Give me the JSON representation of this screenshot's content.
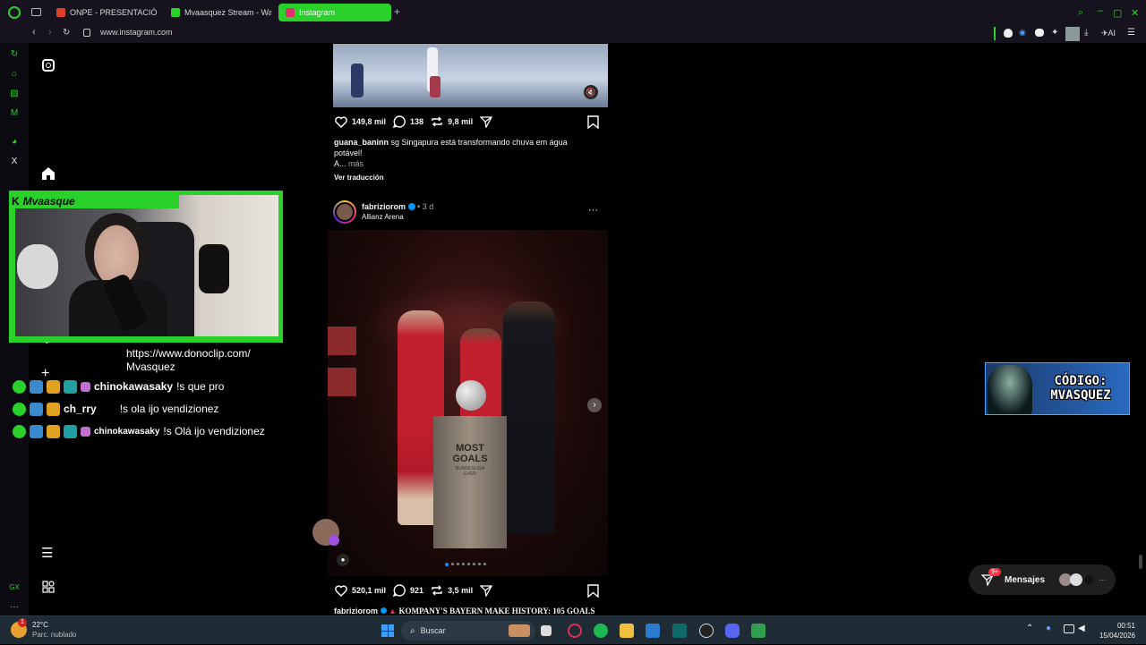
{
  "browser": {
    "tabs": [
      {
        "label": "ONPE - PRESENTACIÓN D",
        "favicon_color": "#e0402b"
      },
      {
        "label": "Mvaasquez Stream - Watc",
        "favicon_color": "#2bd12b"
      },
      {
        "label": "Instagram",
        "favicon_color": "#e1306c"
      }
    ],
    "url": "www.instagram.com",
    "extension_label": "AI",
    "accent": "#2bd12b"
  },
  "post1": {
    "likes": "149,8 mil",
    "comments": "138",
    "shares": "9,8 mil",
    "username": "guana_baninn",
    "caption": "sg Singapura está transformando chuva em água potável!",
    "caption_more": "A...",
    "more_label": "más",
    "translate_label": "Ver traducción"
  },
  "post2": {
    "username": "fabriziorom",
    "verified": true,
    "time": "3 d",
    "location": "Allianz Arena",
    "trophy_text": "MOST GOALS",
    "trophy_sub": "BUNDESLIGA EVER",
    "likes": "520,1 mil",
    "comments": "921",
    "shares": "3,5 mil",
    "caption_user": "fabriziorom",
    "caption": "KOMPANY'S BAYERN MAKE HISTORY: 105 GOALS"
  },
  "stream": {
    "streamer_name": "Mvaasque",
    "donation_url_line1": "https://www.donoclip.com/",
    "donation_url_line2": "Mvasquez",
    "chat": [
      {
        "user": "chinokawasaky",
        "message": "!s que pro"
      },
      {
        "user": "ch_rry",
        "message": "!s ola ijo vendizionez"
      },
      {
        "user": "chinokawasaky",
        "message": "!s Olá ijo vendizionez"
      }
    ],
    "code_banner_line1": "CÓDIGO:",
    "code_banner_line2": "MVASQUEZ"
  },
  "messages": {
    "label": "Mensajes",
    "badge": "9+"
  },
  "taskbar": {
    "weather_temp": "22°C",
    "weather_desc": "Parc. nublado",
    "weather_badge": "1",
    "search_placeholder": "Buscar",
    "time": "00:51",
    "date": "15/04/2026"
  },
  "side_label": "GX"
}
